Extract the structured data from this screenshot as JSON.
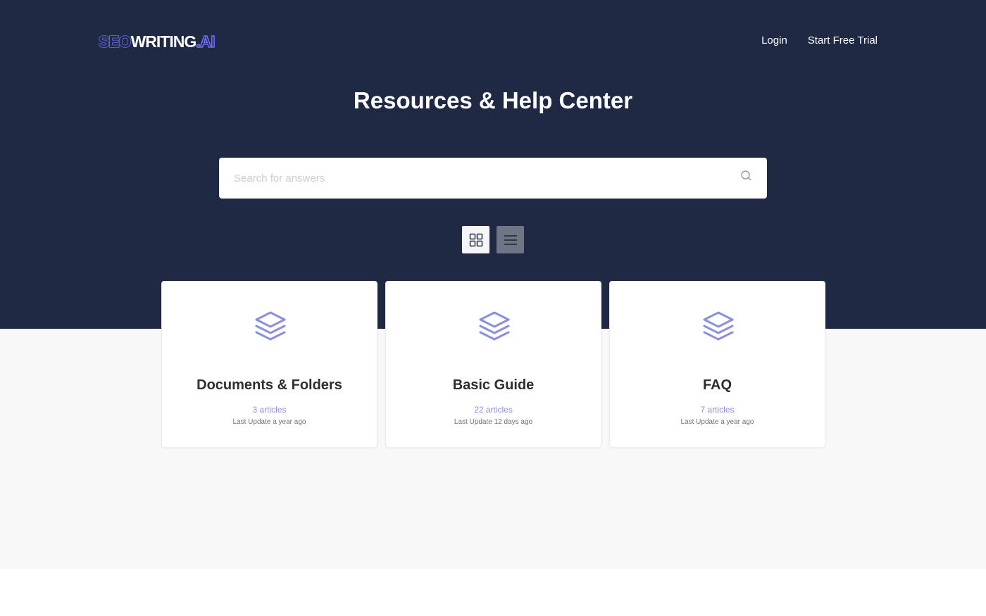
{
  "brand": {
    "logo_seo": "SEO",
    "logo_writing": "WRITING",
    "logo_ai": ".AI",
    "accent": "#6f6ff0",
    "hero_bg": "#1f2943"
  },
  "nav": {
    "login": "Login",
    "trial": "Start Free Trial"
  },
  "hero": {
    "title": "Resources & Help Center"
  },
  "search": {
    "placeholder": "Search for answers",
    "icon": "search-icon"
  },
  "view_toggle": {
    "grid_icon": "grid-view-icon",
    "list_icon": "list-view-icon",
    "selected": "grid"
  },
  "cards": [
    {
      "title": "Documents & Folders",
      "count": "3",
      "count_label": "articles",
      "updated_label": "Last Update",
      "updated": "a year ago",
      "icon": "layers-icon"
    },
    {
      "title": "Basic Guide",
      "count": "22",
      "count_label": "articles",
      "updated_label": "Last Update",
      "updated": "12 days ago",
      "icon": "layers-icon"
    },
    {
      "title": "FAQ",
      "count": "7",
      "count_label": "articles",
      "updated_label": "Last Update",
      "updated": "a year ago",
      "icon": "layers-icon"
    }
  ]
}
